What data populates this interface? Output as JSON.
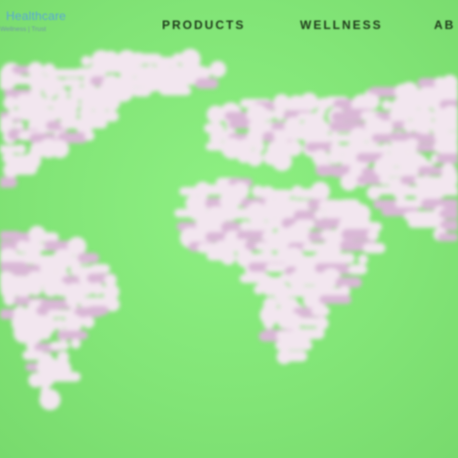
{
  "header": {
    "brand_name": "Healthcare",
    "brand_tagline": "Wellness | Trust",
    "nav": [
      {
        "label": "PRODUCTS"
      },
      {
        "label": "WELLNESS"
      },
      {
        "label": "AB"
      }
    ]
  },
  "hero": {
    "image_icon": "world-map-made-of-pills",
    "background_color": "#84e878",
    "pill_color": "#f2e6ef",
    "pill_tint_color": "#d9b7d6"
  }
}
